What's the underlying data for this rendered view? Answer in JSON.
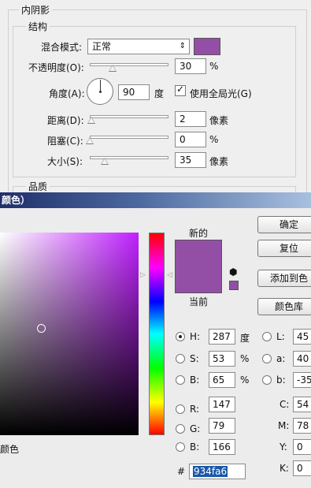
{
  "inner_shadow": {
    "section_title": "内阴影",
    "structure_title": "结构",
    "blend_mode_label": "混合模式:",
    "blend_mode_value": "正常",
    "shadow_color": "#934fa6",
    "opacity_label": "不透明度(O):",
    "opacity_value": "30",
    "opacity_unit": "%",
    "angle_label": "角度(A):",
    "angle_value": "90",
    "angle_unit": "度",
    "global_light_label": "使用全局光(G)",
    "global_light_checked": true,
    "distance_label": "距离(D):",
    "distance_value": "2",
    "distance_unit": "像素",
    "choke_label": "阻塞(C):",
    "choke_value": "0",
    "choke_unit": "%",
    "size_label": "大小(S):",
    "size_value": "35",
    "size_unit": "像素",
    "quality_title": "品质"
  },
  "color_picker": {
    "title": "颜色）",
    "new_label": "新的",
    "current_label": "当前",
    "new_color": "#934fa6",
    "current_color": "#934fa6",
    "buttons": {
      "ok": "确定",
      "reset": "复位",
      "add_swatch": "添加到色",
      "libraries": "颜色库"
    },
    "fields": {
      "H": {
        "label": "H:",
        "value": "287",
        "unit": "度"
      },
      "S": {
        "label": "S:",
        "value": "53",
        "unit": "%"
      },
      "B": {
        "label": "B:",
        "value": "65",
        "unit": "%"
      },
      "R": {
        "label": "R:",
        "value": "147"
      },
      "G": {
        "label": "G:",
        "value": "79"
      },
      "Bl": {
        "label": "B:",
        "value": "166"
      },
      "L": {
        "label": "L:",
        "value": "45"
      },
      "a": {
        "label": "a:",
        "value": "40"
      },
      "b": {
        "label": "b:",
        "value": "-35"
      },
      "C": {
        "label": "C:",
        "value": "54"
      },
      "M": {
        "label": "M:",
        "value": "78"
      },
      "Y": {
        "label": "Y:",
        "value": "0"
      },
      "K": {
        "label": "K:",
        "value": "0"
      }
    },
    "hex_label": "#",
    "hex_value": "934fa6",
    "only_web_label": "颜色"
  }
}
